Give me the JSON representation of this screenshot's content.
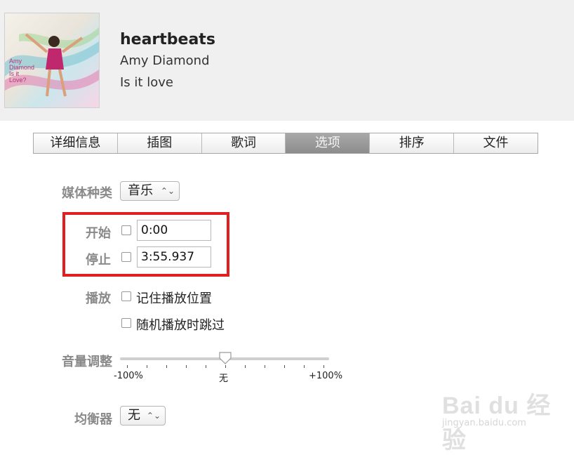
{
  "track": {
    "title": "heartbeats",
    "artist": "Amy Diamond",
    "album": "Is it love",
    "artwork_text": [
      "Amy",
      "Diamond",
      "Is it",
      "Love?"
    ]
  },
  "tabs": [
    {
      "label": "详细信息",
      "active": false
    },
    {
      "label": "插图",
      "active": false
    },
    {
      "label": "歌词",
      "active": false
    },
    {
      "label": "选项",
      "active": true
    },
    {
      "label": "排序",
      "active": false
    },
    {
      "label": "文件",
      "active": false
    }
  ],
  "options": {
    "media_kind_label": "媒体种类",
    "media_kind_value": "音乐",
    "start_label": "开始",
    "start_value": "0:00",
    "start_checked": false,
    "stop_label": "停止",
    "stop_value": "3:55.937",
    "stop_checked": false,
    "playback_label": "播放",
    "remember_position_label": "记住播放位置",
    "remember_position_checked": false,
    "skip_shuffle_label": "随机播放时跳过",
    "skip_shuffle_checked": false,
    "volume_label": "音量调整",
    "volume_min": "-100%",
    "volume_mid": "无",
    "volume_max": "+100%",
    "volume_adjust_percent": 0,
    "equalizer_label": "均衡器",
    "equalizer_value": "无"
  },
  "watermark": {
    "main": "Bai du 经验",
    "sub": "jingyan.baidu.com"
  },
  "colors": {
    "highlight_box": "#e02020",
    "active_tab": "#999999"
  }
}
